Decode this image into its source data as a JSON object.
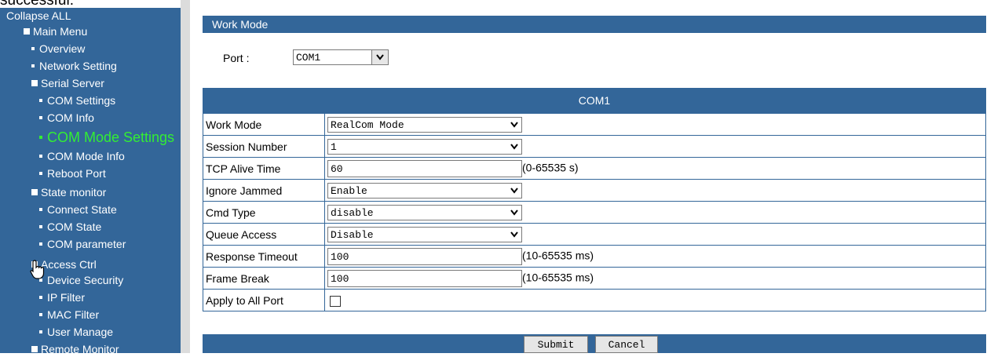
{
  "top_cut_text": "successful.",
  "sidebar": {
    "collapse_all": "Collapse ALL",
    "main_menu": "Main Menu",
    "items": {
      "overview": "Overview",
      "network_setting": "Network Setting",
      "serial_server": "Serial Server",
      "com_settings": "COM Settings",
      "com_info": "COM Info",
      "com_mode_settings": "COM Mode Settings",
      "com_mode_info": "COM Mode Info",
      "reboot_port": "Reboot Port",
      "state_monitor": "State monitor",
      "connect_state": "Connect State",
      "com_state": "COM State",
      "com_parameter": "COM parameter",
      "access_ctrl": "Access Ctrl",
      "device_security": "Device Security",
      "ip_filter": "IP Filter",
      "mac_filter": "MAC Filter",
      "user_manage": "User Manage",
      "remote_monitor": "Remote Monitor"
    }
  },
  "page": {
    "header": "Work Mode",
    "port_label": "Port :",
    "port_value": "COM1",
    "table_title": "COM1",
    "rows": {
      "work_mode": {
        "label": "Work Mode",
        "value": "RealCom Mode"
      },
      "session_number": {
        "label": "Session Number",
        "value": "1"
      },
      "tcp_alive_time": {
        "label": "TCP Alive Time",
        "value": "60",
        "hint": "(0-65535 s)"
      },
      "ignore_jammed": {
        "label": "Ignore Jammed",
        "value": "Enable"
      },
      "cmd_type": {
        "label": "Cmd Type",
        "value": "disable"
      },
      "queue_access": {
        "label": "Queue Access",
        "value": "Disable"
      },
      "response_timeout": {
        "label": "Response Timeout",
        "value": "100",
        "hint": "(10-65535 ms)"
      },
      "frame_break": {
        "label": "Frame Break",
        "value": "100",
        "hint": "(10-65535 ms)"
      },
      "apply_all": {
        "label": "Apply to All Port",
        "checked": false
      }
    },
    "submit_label": "Submit",
    "cancel_label": "Cancel"
  },
  "colors": {
    "accent": "#336699",
    "active_menu": "#33ee33",
    "gutter": "#dcdcdc"
  }
}
